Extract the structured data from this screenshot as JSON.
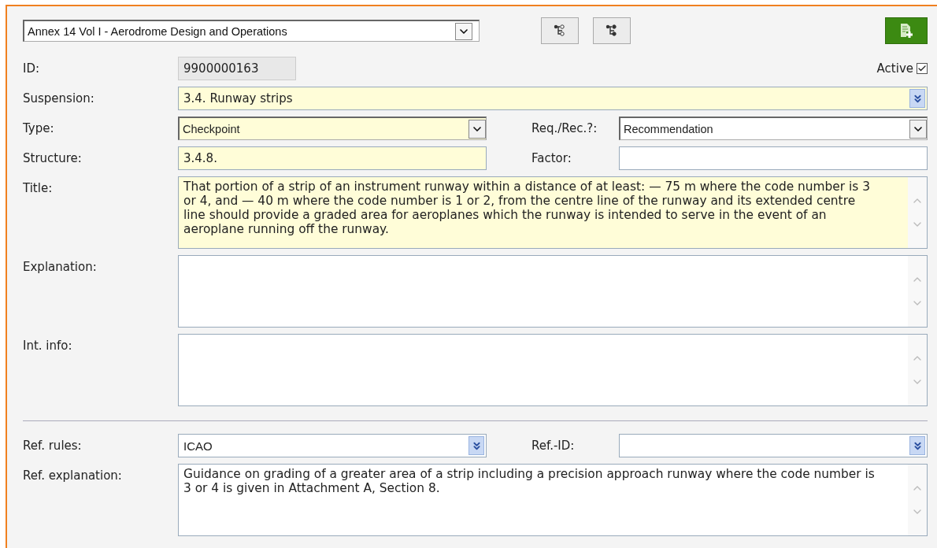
{
  "document_select": {
    "value": "Annex 14 Vol I - Aerodrome Design and Operations"
  },
  "id_row": {
    "label": "ID:",
    "value": "9900000163"
  },
  "active": {
    "label": "Active",
    "checked": true
  },
  "rows": [
    {
      "fields": [
        {
          "kind": "combo",
          "label": "Suspension:",
          "value": "3.4. Runway strips",
          "required": true
        }
      ]
    },
    {
      "fields": [
        {
          "kind": "select",
          "label": "Type:",
          "value": "Checkpoint",
          "required": true
        },
        {
          "kind": "select",
          "label": "Req./Rec.?:",
          "value": "Recommendation",
          "required": false
        }
      ]
    },
    {
      "fields": [
        {
          "kind": "text",
          "label": "Structure:",
          "value": "3.4.8.",
          "required": true
        },
        {
          "kind": "text",
          "label": "Factor:",
          "required": false
        }
      ]
    },
    {
      "fields": [
        {
          "kind": "textarea",
          "label": "Title:",
          "value": "That portion of a strip of an instrument runway within a distance of at least: — 75 m where the code number is 3 or 4, and — 40 m where the code number is 1 or 2, from the centre line of the runway and its extended centre line should provide a graded area for aeroplanes which the runway is intended to serve in the event of an aeroplane running off the runway.",
          "required": true
        }
      ]
    },
    {
      "fields": [
        {
          "kind": "textarea",
          "label": "Explanation:",
          "required": false
        }
      ]
    },
    {
      "fields": [
        {
          "kind": "textarea",
          "label": "Int. info:",
          "required": false
        }
      ]
    },
    {
      "kind": "divider",
      "fields": []
    },
    {
      "fields": [
        {
          "kind": "combo",
          "label": "Ref. rules:",
          "value": "ICAO",
          "required": false
        },
        {
          "kind": "combo",
          "label": "Ref.-ID:",
          "required": false
        }
      ]
    },
    {
      "fields": [
        {
          "kind": "textarea",
          "label": "Ref. explanation:",
          "value": "Guidance on grading of a greater area of a strip including a precision approach runway where the code number is 3 or 4 is given in Attachment A, Section 8.",
          "required": false
        }
      ]
    }
  ]
}
